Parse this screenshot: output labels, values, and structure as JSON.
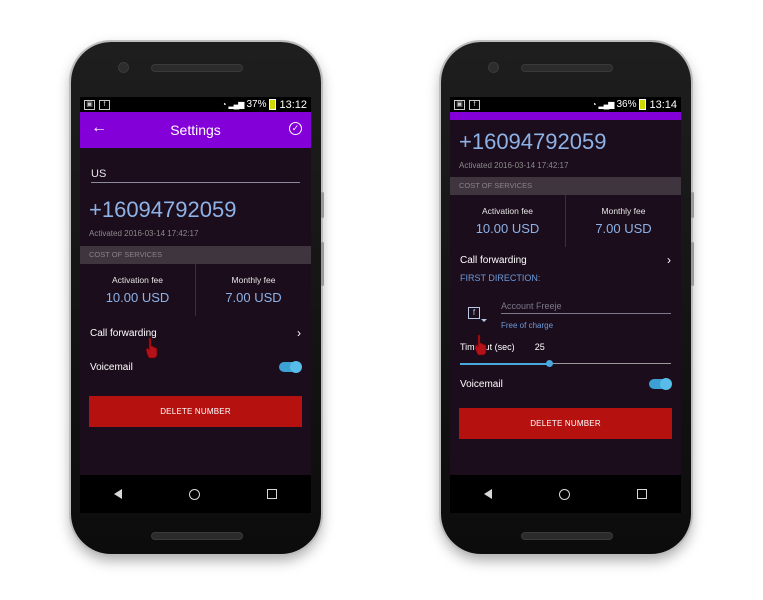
{
  "left": {
    "status": {
      "battery": "37%",
      "time": "13:12"
    },
    "appbar": {
      "title": "Settings",
      "back_glyph": "←",
      "check_glyph": "✓"
    },
    "country": "US",
    "number": "+16094792059",
    "activated": "Activated 2016-03-14 17:42:17",
    "section": "COST OF SERVICES",
    "activation_fee_label": "Activation fee",
    "activation_fee_value": "10.00 USD",
    "monthly_fee_label": "Monthly fee",
    "monthly_fee_value": "7.00 USD",
    "call_forwarding": "Call forwarding",
    "voicemail": "Voicemail",
    "voicemail_enabled": true,
    "delete": "DELETE NUMBER",
    "chevron": "›"
  },
  "right": {
    "status": {
      "battery": "36%",
      "time": "13:14"
    },
    "number": "+16094792059",
    "activated": "Activated 2016-03-14 17:42:17",
    "section": "COST OF SERVICES",
    "activation_fee_label": "Activation fee",
    "activation_fee_value": "10.00 USD",
    "monthly_fee_label": "Monthly fee",
    "monthly_fee_value": "7.00 USD",
    "call_forwarding": "Call forwarding",
    "first_direction": "FIRST DIRECTION:",
    "account_placeholder": "Account Freeje",
    "free_of_charge": "Free of charge",
    "timeout_label": "Timeout (sec)",
    "timeout_value": "25",
    "timeout_fraction": 0.42,
    "voicemail": "Voicemail",
    "voicemail_enabled": true,
    "delete": "DELETE NUMBER",
    "chevron": "›"
  },
  "icons": {
    "statusbar": [
      "image-icon",
      "facebook-icon",
      "wifi-icon",
      "signal-icon",
      "battery-icon"
    ],
    "nav": [
      "back-triangle-icon",
      "home-circle-icon",
      "recents-square-icon"
    ],
    "cursor": "hand-pointer-icon"
  },
  "colors": {
    "appbar": "#8400d9",
    "accent": "#8fb2e6",
    "delete": "#b5110f",
    "toggle": "#4aa8de",
    "screen_bg": "#1b0d1c"
  }
}
